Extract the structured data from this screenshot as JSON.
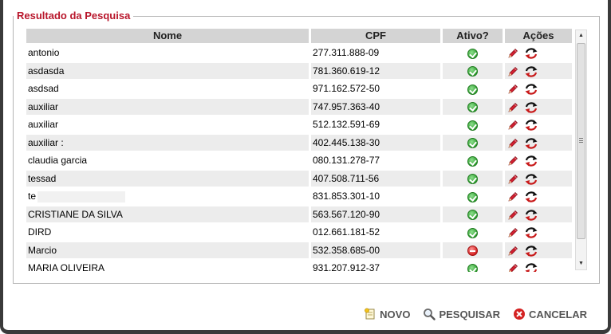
{
  "panel": {
    "title": "Resultado da Pesquisa"
  },
  "table": {
    "columns": [
      "Nome",
      "CPF",
      "Ativo?",
      "Ações"
    ],
    "rows": [
      {
        "nome": "antonio",
        "cpf": "277.311.888-09",
        "ativo": true
      },
      {
        "nome": "asdasda",
        "cpf": "781.360.619-12",
        "ativo": true
      },
      {
        "nome": "asdsad",
        "cpf": "971.162.572-50",
        "ativo": true
      },
      {
        "nome": "auxiliar",
        "cpf": "747.957.363-40",
        "ativo": true
      },
      {
        "nome": "auxiliar",
        "cpf": "512.132.591-69",
        "ativo": true
      },
      {
        "nome": "auxiliar :",
        "cpf": "402.445.138-30",
        "ativo": true
      },
      {
        "nome": "claudia garcia",
        "cpf": "080.131.278-77",
        "ativo": true
      },
      {
        "nome": "tessad",
        "cpf": "407.508.711-56",
        "ativo": true
      },
      {
        "nome": "te",
        "cpf": "831.853.301-10",
        "ativo": true
      },
      {
        "nome": "CRISTIANE DA SILVA",
        "cpf": "563.567.120-90",
        "ativo": true
      },
      {
        "nome": "DIRD",
        "cpf": "012.661.181-52",
        "ativo": true
      },
      {
        "nome": "Marcio",
        "cpf": "532.358.685-00",
        "ativo": false
      },
      {
        "nome": "MARIA OLIVEIRA",
        "cpf": "931.207.912-37",
        "ativo": true
      }
    ]
  },
  "icons": {
    "edit": "pencil-icon",
    "refresh": "refresh-icon",
    "active": "check-circle-icon",
    "inactive": "minus-circle-icon"
  },
  "footer": {
    "novo": "NOVO",
    "pesquisar": "PESQUISAR",
    "cancelar": "CANCELAR"
  },
  "colors": {
    "legend": "#b8162b",
    "header": "#d4d4d4",
    "row_alt": "#ececec",
    "active": "#2e9e2e",
    "inactive": "#d42222",
    "edit": "#d02030"
  }
}
